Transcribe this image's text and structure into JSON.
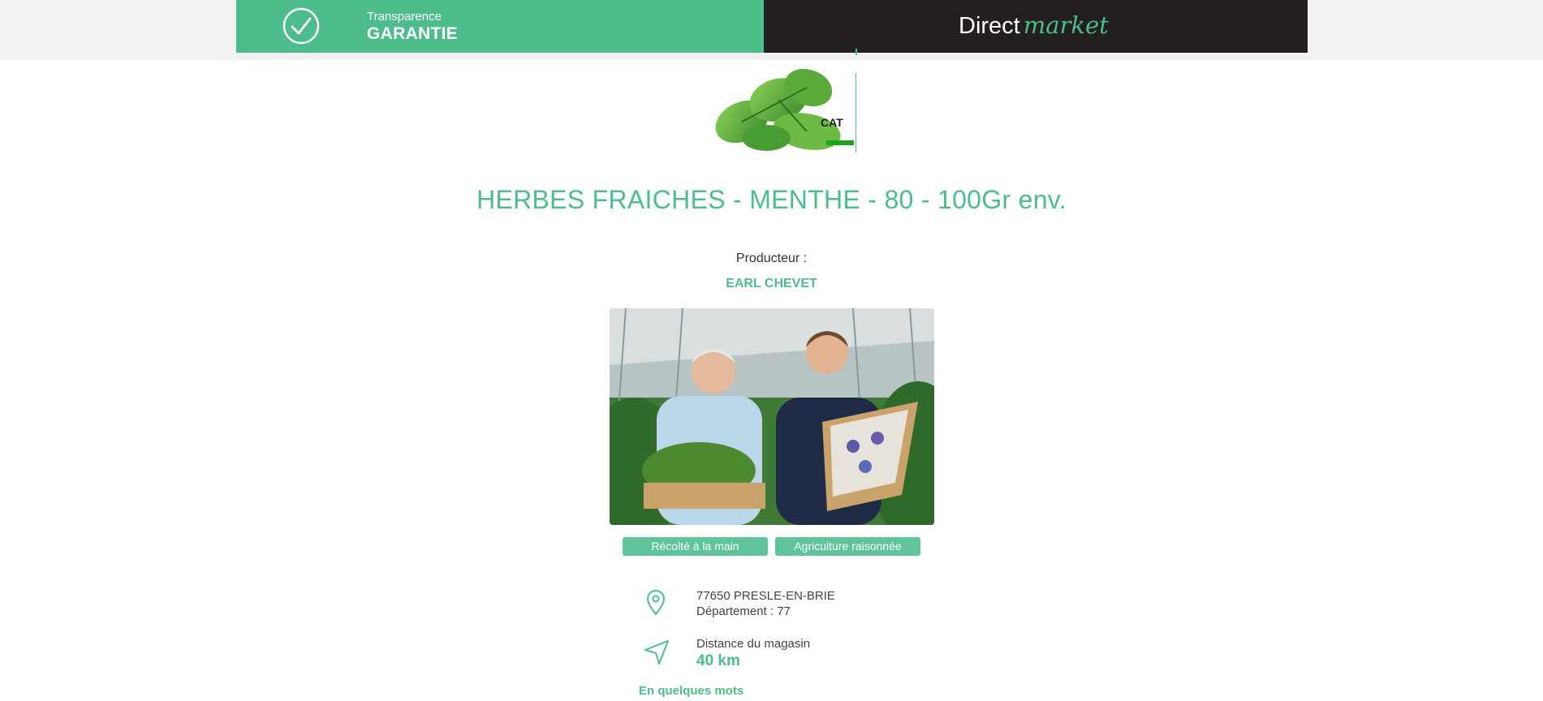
{
  "header": {
    "badge_small": "Transparence",
    "badge_big": "GARANTIE",
    "logo_part1": "Direct",
    "logo_part2": "market"
  },
  "product": {
    "thumb_badge": "CAT",
    "title": "HERBES FRAICHES - MENTHE - 80 - 100Gr env."
  },
  "producer": {
    "label": "Producteur :",
    "name": "EARL CHEVET",
    "tags": [
      "Récolté à la main",
      "Agriculture raisonnée"
    ]
  },
  "location": {
    "address": "77650 PRESLE-EN-BRIE",
    "department": "Département : 77",
    "distance_label": "Distance du magasin",
    "distance_value": "40 km"
  },
  "section": {
    "about": "En quelques mots"
  },
  "colors": {
    "accent": "#4dbd8c",
    "dark": "#231f20",
    "tag": "#5fc49b"
  },
  "icons": [
    "check-circle-icon",
    "map-pin-icon",
    "navigation-arrow-icon"
  ]
}
